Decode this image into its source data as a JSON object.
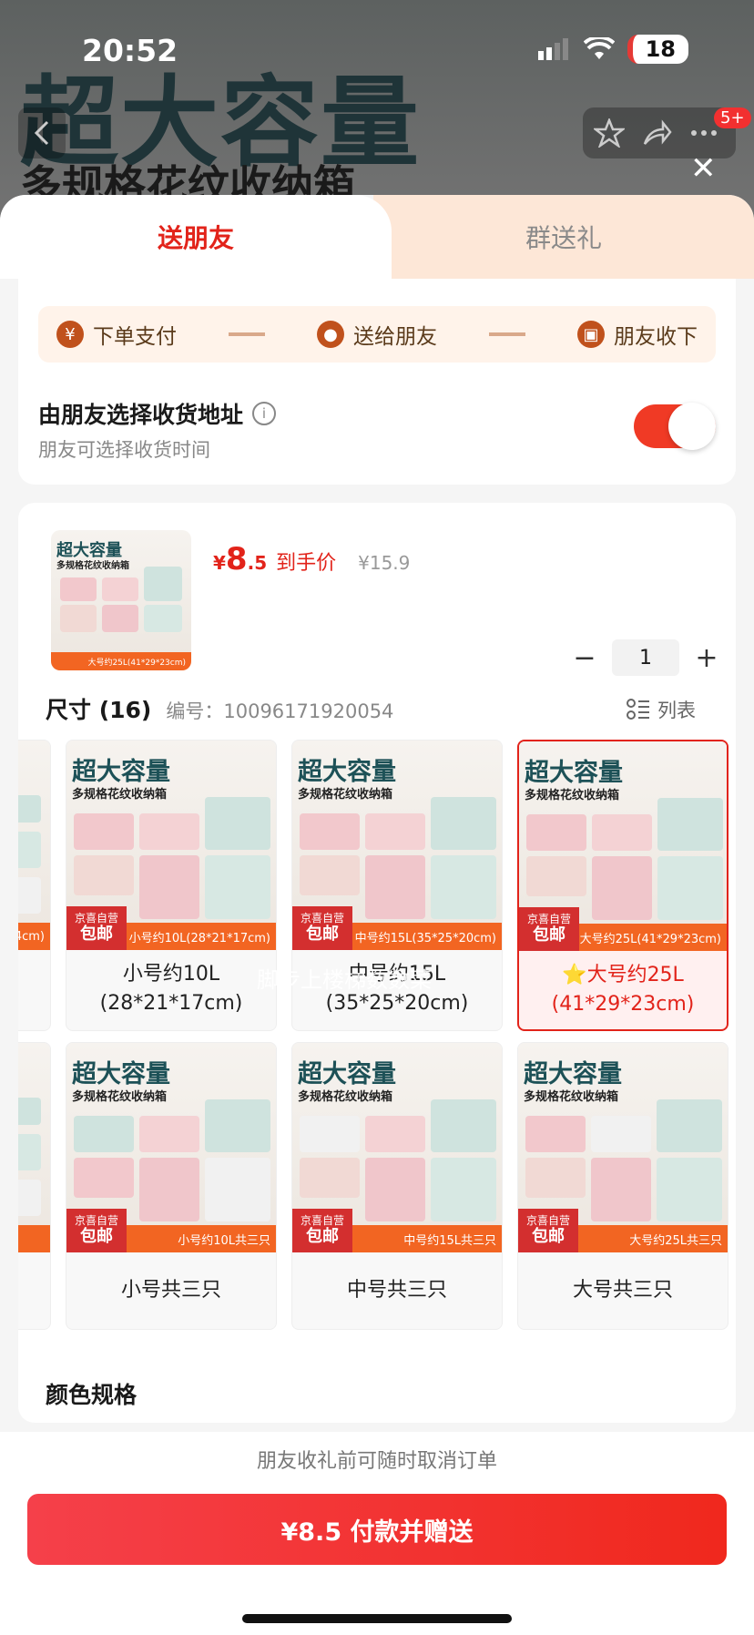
{
  "status_bar": {
    "time": "20:52",
    "battery": "18"
  },
  "background": {
    "title": "超大容量",
    "subtitle": "多规格花纹收纳箱",
    "nav_badge": "5+"
  },
  "tabs": [
    {
      "label": "送朋友"
    },
    {
      "label": "群送礼"
    }
  ],
  "steps": [
    {
      "label": "下单支付",
      "icon": "yen-icon"
    },
    {
      "label": "送给朋友",
      "icon": "wechat-icon"
    },
    {
      "label": "朋友收下",
      "icon": "gift-icon"
    }
  ],
  "address": {
    "title": "由朋友选择收货地址",
    "subtitle": "朋友可选择收货时间",
    "toggle_on": true
  },
  "product": {
    "price_symbol": "¥",
    "price_int": "8",
    "price_dec": ".5",
    "price_label": "到手价",
    "orig_price": "¥15.9",
    "quantity": "1",
    "thumb_title": "超大容量",
    "thumb_sub": "多规格花纹收纳箱",
    "thumb_band": "大号约25L(41*29*23cm)"
  },
  "sizes": {
    "title": "尺寸 (16)",
    "code_label": "编号：",
    "code": "10096171920054",
    "list_label": "列表",
    "watermark": "脚步上楼梯数数菜",
    "row1": [
      {
        "label": "小号约10L\n(28*21*17cm)",
        "band": "小号约10L(28*21*17cm)",
        "selected": false
      },
      {
        "label": "中号约15L\n(35*25*20cm)",
        "band": "中号约15L(35*25*20cm)",
        "selected": false
      },
      {
        "label": "⭐大号约25L\n(41*29*23cm)",
        "band": "大号约25L(41*29*23cm)",
        "selected": true
      }
    ],
    "row2": [
      {
        "label": "小号共三只",
        "band": "小号约10L共三只",
        "selected": false
      },
      {
        "label": "中号共三只",
        "band": "中号约15L共三只",
        "selected": false
      },
      {
        "label": "大号共三只",
        "band": "大号约25L共三只",
        "selected": false
      }
    ],
    "img_title": "超大容量",
    "img_sub": "多规格花纹收纳箱",
    "logo_top": "京喜自营",
    "logo_bottom": "包邮",
    "edge_band": "4cm)"
  },
  "color_spec": {
    "title": "颜色规格"
  },
  "footer": {
    "notice": "朋友收礼前可随时取消订单",
    "pay_label": "¥8.5 付款并赠送"
  },
  "colors": {
    "accent": "#e2231a",
    "tab_inactive_bg": "#fde7d7",
    "band": "#f26522"
  }
}
